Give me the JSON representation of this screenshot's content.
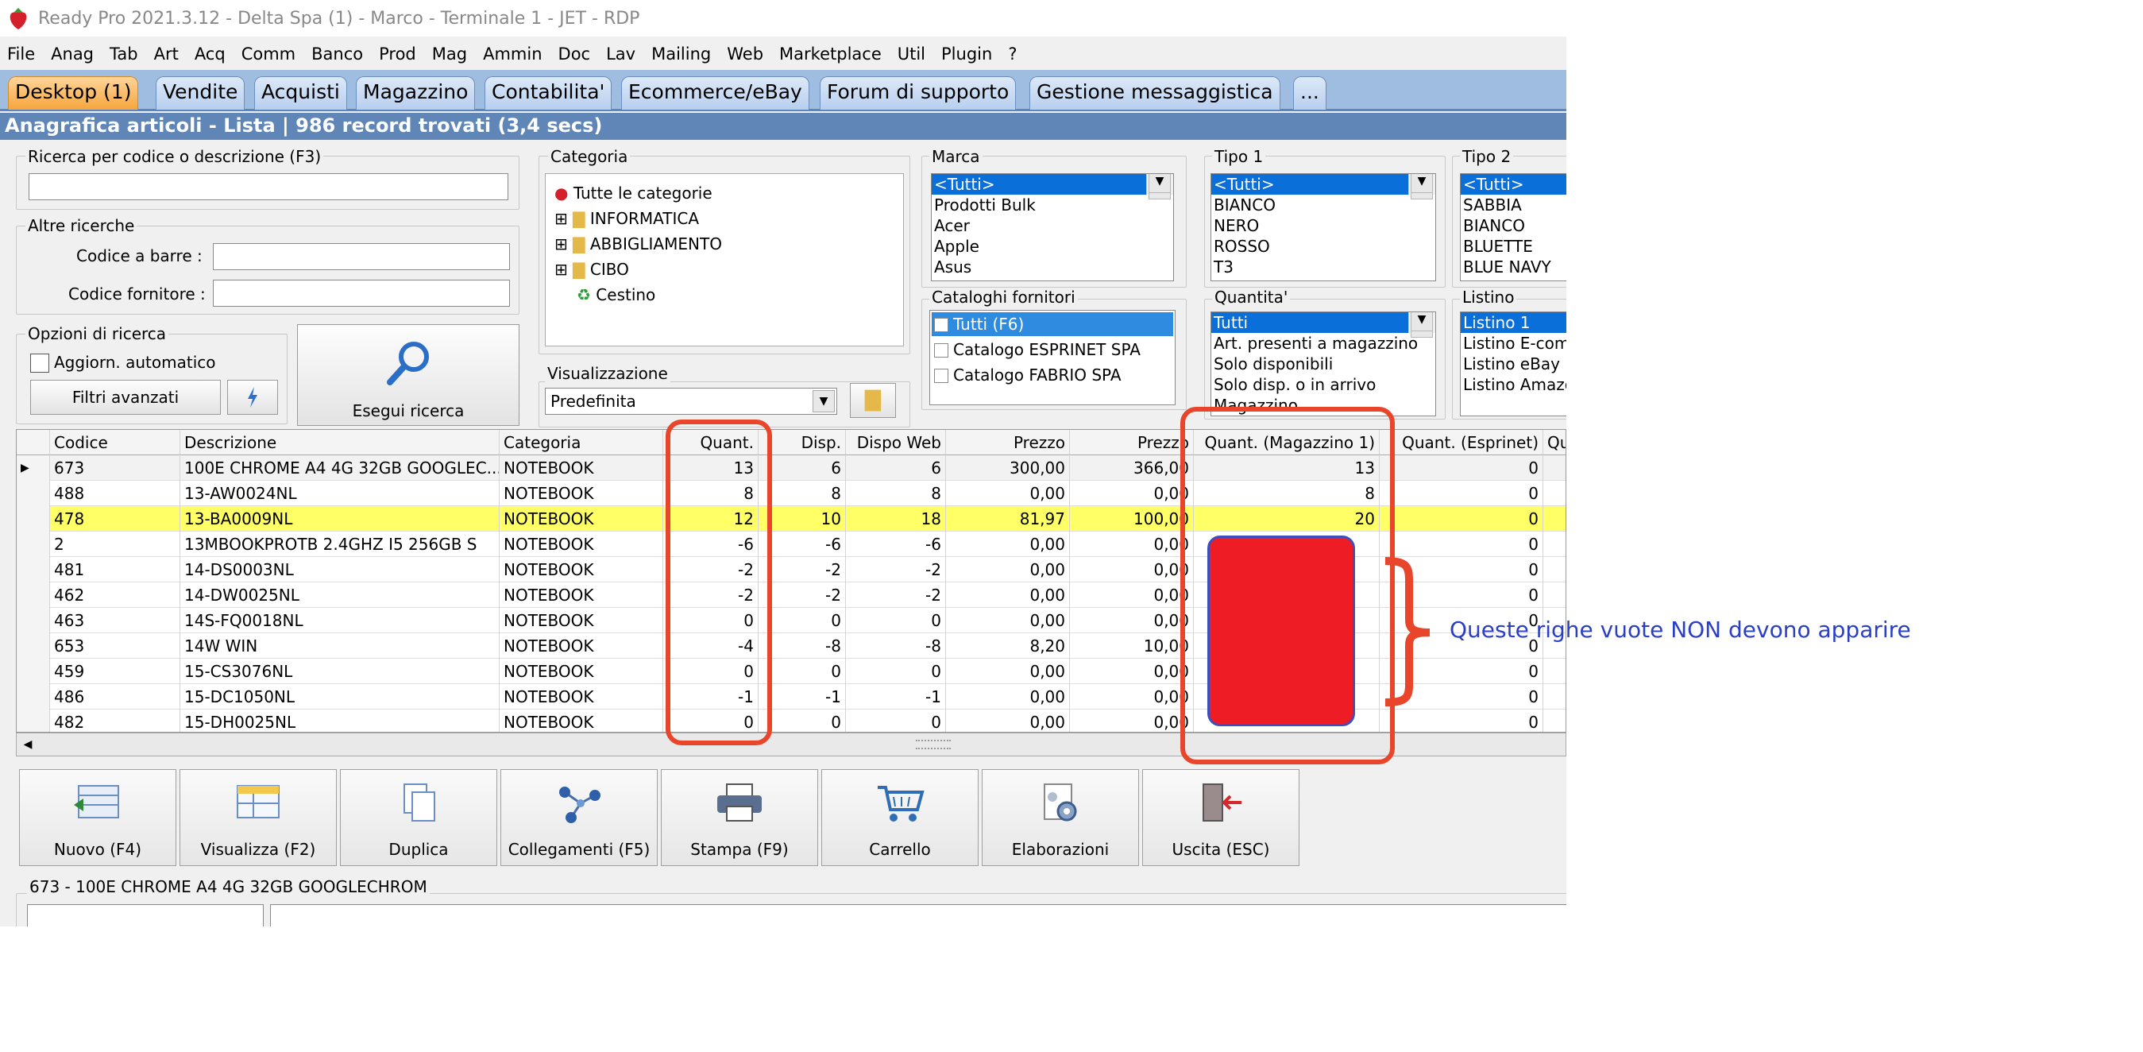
{
  "window": {
    "title": "Ready Pro 2021.3.12 - Delta Spa (1) - Marco - Terminale 1 - JET - RDP"
  },
  "menu": [
    "File",
    "Anag",
    "Tab",
    "Art",
    "Acq",
    "Comm",
    "Banco",
    "Prod",
    "Mag",
    "Ammin",
    "Doc",
    "Lav",
    "Mailing",
    "Web",
    "Marketplace",
    "Util",
    "Plugin",
    "?"
  ],
  "tabs": [
    "Desktop (1)",
    "Vendite",
    "Acquisti",
    "Magazzino",
    "Contabilita'",
    "Ecommerce/eBay",
    "Forum di supporto",
    "Gestione messaggistica",
    "..."
  ],
  "header": "Anagrafica articoli  - Lista | 986 record trovati (3,4 secs)",
  "search": {
    "label": "Ricerca per codice o descrizione (F3)",
    "value": "",
    "altre": "Altre ricerche",
    "barcode_label": "Codice a barre :",
    "fornitore_label": "Codice fornitore :",
    "opzioni": "Opzioni di ricerca",
    "aggiorn": "Aggiorn. automatico",
    "filtri": "Filtri avanzati",
    "esegui": "Esegui ricerca"
  },
  "categoria": {
    "label": "Categoria",
    "items": [
      "Tutte le categorie",
      "INFORMATICA",
      "ABBIGLIAMENTO",
      "CIBO",
      "Cestino"
    ]
  },
  "visualizzazione": {
    "label": "Visualizzazione",
    "value": "Predefinita"
  },
  "marca": {
    "label": "Marca",
    "items": [
      "<Tutti>",
      "Prodotti Bulk",
      "Acer",
      "Apple",
      "Asus"
    ]
  },
  "tipo1": {
    "label": "Tipo 1",
    "items": [
      "<Tutti>",
      "BIANCO",
      "NERO",
      "ROSSO",
      "T3"
    ]
  },
  "tipo2": {
    "label": "Tipo 2",
    "items": [
      "<Tutti>",
      "SABBIA",
      "BIANCO",
      "BLUETTE",
      "BLUE NAVY"
    ]
  },
  "cataloghi": {
    "label": "Cataloghi fornitori",
    "items": [
      "Tutti (F6)",
      "Catalogo ESPRINET SPA",
      "Catalogo FABRIO SPA"
    ]
  },
  "quantita": {
    "label": "Quantita'",
    "items": [
      "Tutti",
      "Art. presenti a magazzino",
      "Solo disponibili",
      "Solo disp. o in arrivo",
      "Magazzino"
    ]
  },
  "listino": {
    "label": "Listino",
    "items": [
      "Listino 1",
      "Listino E-comm",
      "Listino eBay",
      "Listino Amazo"
    ]
  },
  "grid": {
    "columns": [
      "Codice",
      "Descrizione",
      "Categoria",
      "Quant.",
      "Disp.",
      "Dispo Web",
      "Prezzo",
      "Prezzo",
      "Quant. (Magazzino 1)",
      "Quant. (Esprinet)",
      "Qua"
    ],
    "rows": [
      [
        "673",
        "100E CHROME A4 4G 32GB GOOGLEC...",
        "NOTEBOOK",
        "13",
        "6",
        "6",
        "300,00",
        "366,00",
        "13",
        "0"
      ],
      [
        "488",
        "13-AW0024NL",
        "NOTEBOOK",
        "8",
        "8",
        "8",
        "0,00",
        "0,00",
        "8",
        "0"
      ],
      [
        "478",
        "13-BA0009NL",
        "NOTEBOOK",
        "12",
        "10",
        "18",
        "81,97",
        "100,00",
        "20",
        "0"
      ],
      [
        "2",
        "13MBOOKPROTB 2.4GHZ I5 256GB S",
        "NOTEBOOK",
        "-6",
        "-6",
        "-6",
        "0,00",
        "0,00",
        "",
        "0"
      ],
      [
        "481",
        "14-DS0003NL",
        "NOTEBOOK",
        "-2",
        "-2",
        "-2",
        "0,00",
        "0,00",
        "",
        "0"
      ],
      [
        "462",
        "14-DW0025NL",
        "NOTEBOOK",
        "-2",
        "-2",
        "-2",
        "0,00",
        "0,00",
        "",
        "0"
      ],
      [
        "463",
        "14S-FQ0018NL",
        "NOTEBOOK",
        "0",
        "0",
        "0",
        "0,00",
        "0,00",
        "",
        "0"
      ],
      [
        "653",
        "14W WIN",
        "NOTEBOOK",
        "-4",
        "-8",
        "-8",
        "8,20",
        "10,00",
        "",
        "0"
      ],
      [
        "459",
        "15-CS3076NL",
        "NOTEBOOK",
        "0",
        "0",
        "0",
        "0,00",
        "0,00",
        "",
        "0"
      ],
      [
        "486",
        "15-DC1050NL",
        "NOTEBOOK",
        "-1",
        "-1",
        "-1",
        "0,00",
        "0,00",
        "",
        "0"
      ],
      [
        "482",
        "15-DH0025NL",
        "NOTEBOOK",
        "0",
        "0",
        "0",
        "0,00",
        "0,00",
        "",
        "0"
      ]
    ]
  },
  "buttons": [
    "Nuovo (F4)",
    "Visualizza (F2)",
    "Duplica",
    "Collegamenti (F5)",
    "Stampa (F9)",
    "Carrello",
    "Elaborazioni",
    "Uscita (ESC)"
  ],
  "detail": "673 - 100E CHROME A4 4G 32GB GOOGLECHROM",
  "annotation": "Queste righe vuote NON devono apparire",
  "colors": {
    "tab_active": "#f6a63c",
    "header": "#5f86b7",
    "highlight_row": "#ffff66",
    "annotation_red": "#e8452b",
    "fill_red": "#ee1c25",
    "note_blue": "#2a3fc4"
  }
}
